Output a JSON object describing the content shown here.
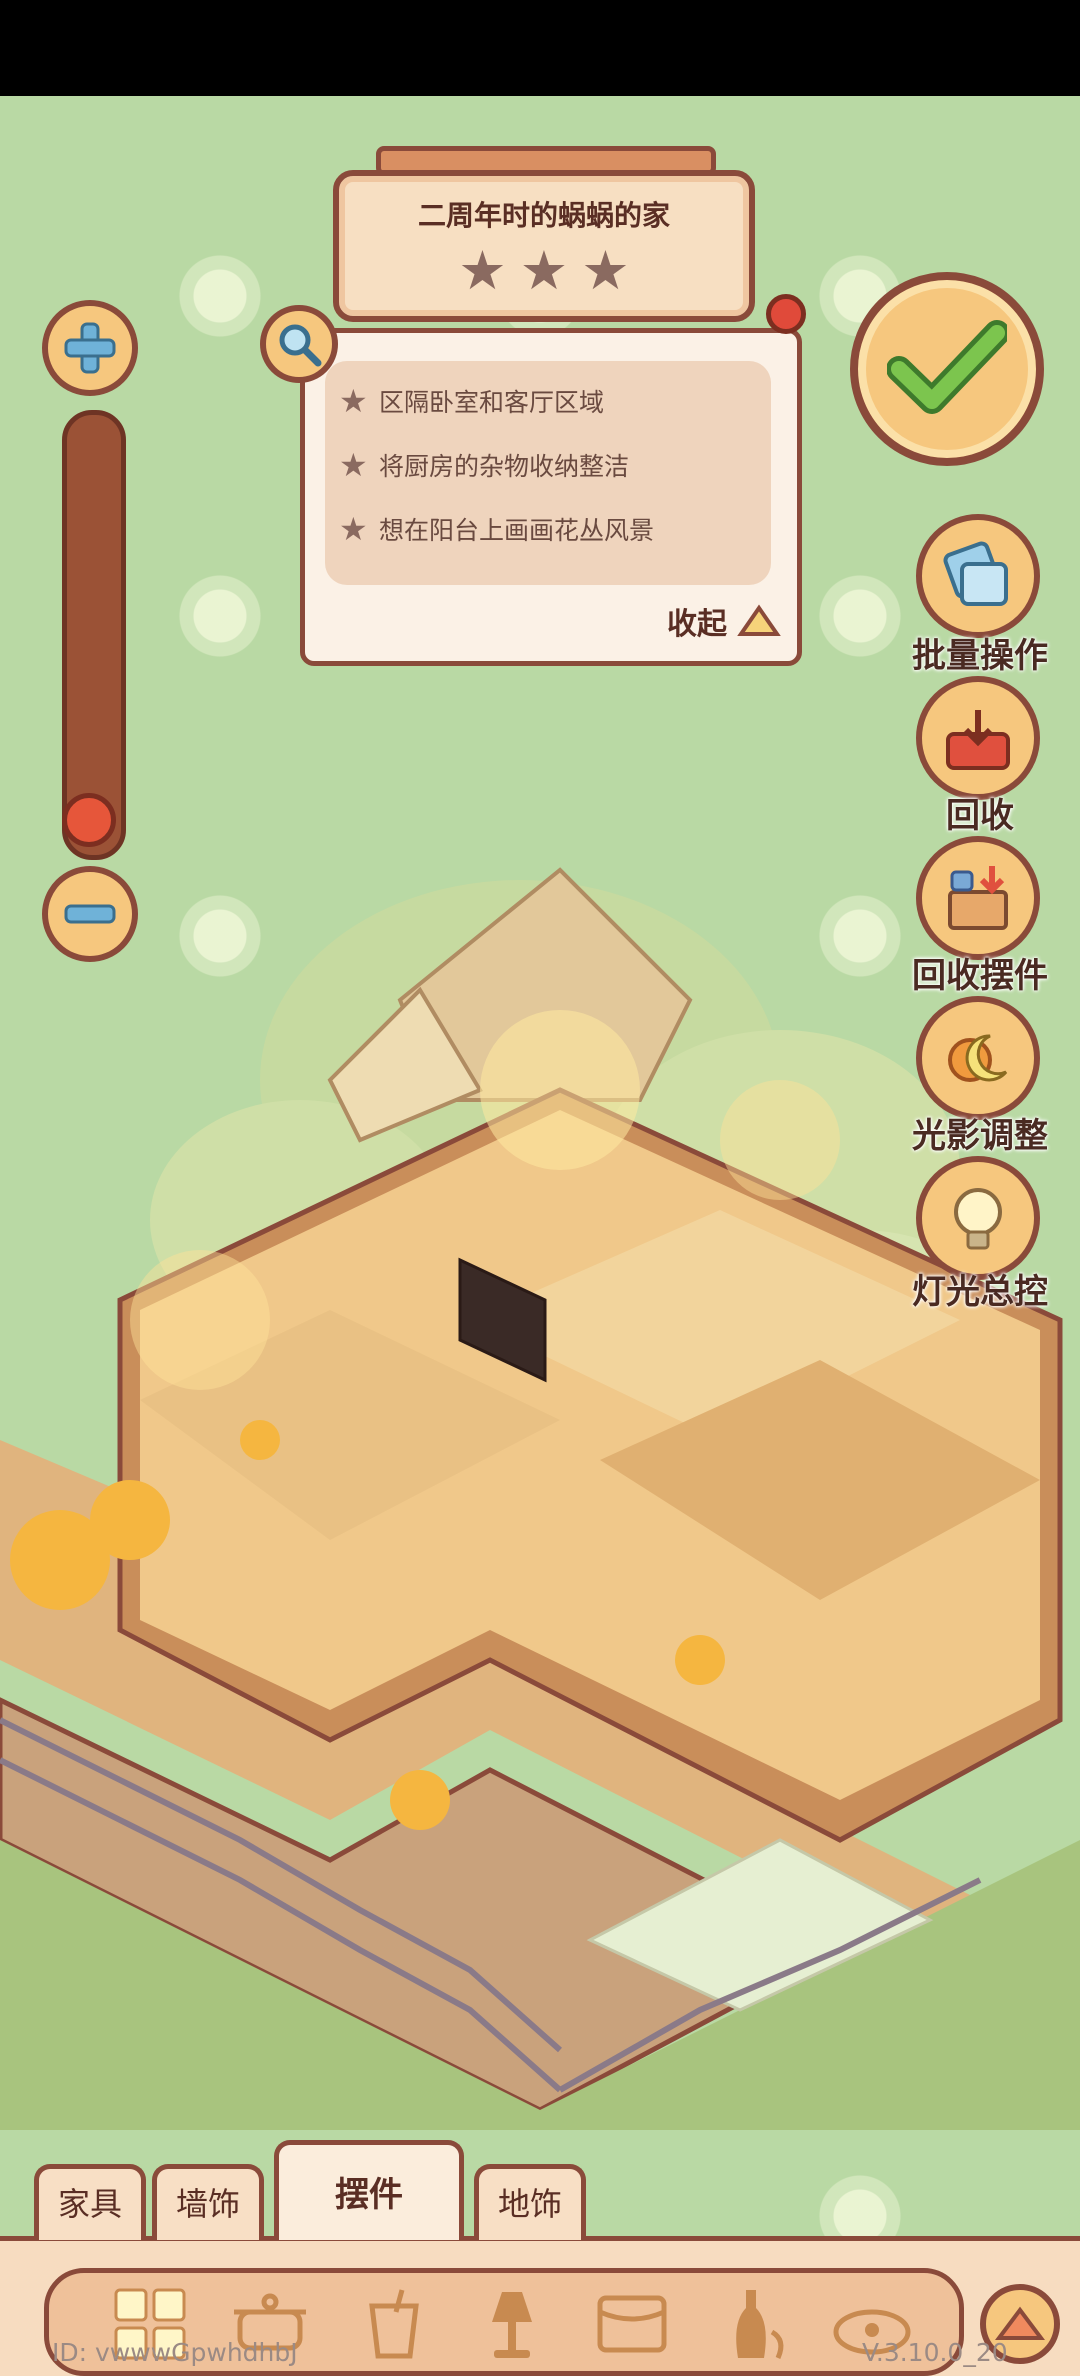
{
  "title": {
    "text": "二周年时的蜗蜗的家",
    "stars_total": 3,
    "stars_filled": 0
  },
  "quests": {
    "items": [
      {
        "text": "区隔卧室和客厅区域"
      },
      {
        "text": "将厨房的杂物收纳整洁"
      },
      {
        "text": "想在阳台上画画花丛风景"
      }
    ],
    "collapse_label": "收起"
  },
  "zoom": {
    "level": 0.02
  },
  "actions": [
    {
      "label": "批量操作",
      "icon": "batch-select-icon"
    },
    {
      "label": "回收",
      "icon": "recycle-box-icon"
    },
    {
      "label": "回收摆件",
      "icon": "recycle-ornament-icon"
    },
    {
      "label": "光影调整",
      "icon": "sun-moon-icon"
    },
    {
      "label": "灯光总控",
      "icon": "lightbulb-icon"
    }
  ],
  "tabs": [
    {
      "label": "家具"
    },
    {
      "label": "墙饰"
    },
    {
      "label": "摆件",
      "selected": true
    },
    {
      "label": "地饰"
    }
  ],
  "categories": [
    "grid-icon",
    "pot-icon",
    "cup-icon",
    "lamp-icon",
    "frame-icon",
    "vase-icon",
    "pet-bowl-icon"
  ],
  "footer": {
    "id": "ID:  vwwwGpwhdhbJ",
    "version": "V.3.10.0_20"
  },
  "colors": {
    "background": "#b9d9a4",
    "panel": "#f7dcc0",
    "border": "#8a4a3a",
    "button": "#f6c77e",
    "check": "#6fb94a"
  }
}
